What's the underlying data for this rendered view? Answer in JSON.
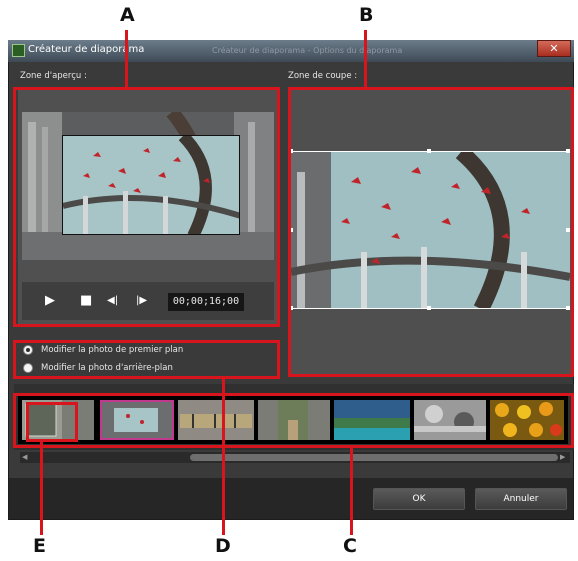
{
  "window": {
    "title": "Créateur de diaporama",
    "ghost_title": "Créateur de diaporama - Options du diaporama",
    "close_glyph": "✕"
  },
  "preview": {
    "label": "Zone d'aperçu :",
    "timecode": "00;00;16;00",
    "controls": {
      "play": "▶",
      "stop": "■",
      "prev_frame": "◀|",
      "next_frame": "|▶"
    }
  },
  "crop": {
    "label": "Zone de coupe :"
  },
  "options": {
    "items": [
      {
        "label": "Modifier la photo de premier plan",
        "selected": true
      },
      {
        "label": "Modifier la photo d'arrière-plan",
        "selected": false
      }
    ]
  },
  "scroll": {
    "left_arrow": "◀",
    "right_arrow": "▶"
  },
  "buttons": {
    "ok": "OK",
    "cancel": "Annuler"
  },
  "callouts": {
    "a": "A",
    "b": "B",
    "c": "C",
    "d": "D",
    "e": "E"
  },
  "colors": {
    "callout_red": "#d8141c",
    "selected_thumb": "#c0398f",
    "window_bg": "#3a3a3a"
  },
  "icons": [
    "app-icon",
    "close-icon",
    "play-icon",
    "stop-icon",
    "prev-frame-icon",
    "next-frame-icon",
    "scroll-left-icon",
    "scroll-right-icon"
  ]
}
